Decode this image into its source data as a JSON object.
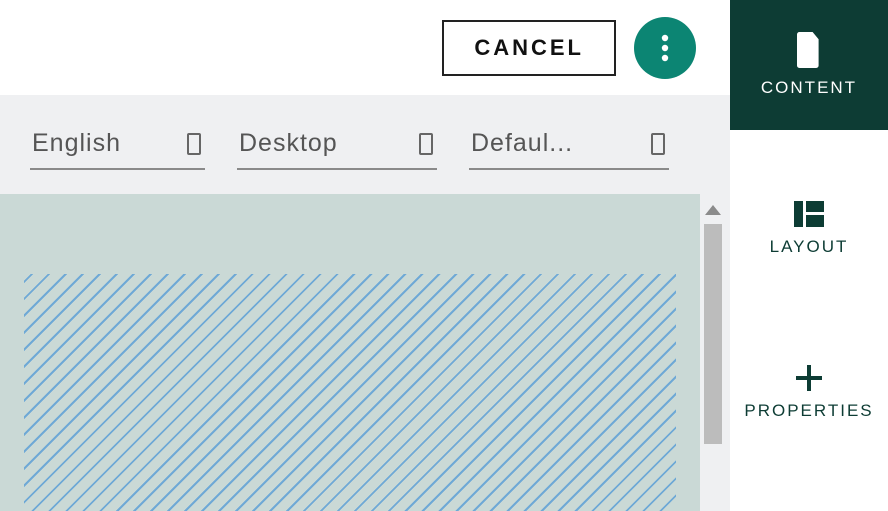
{
  "topbar": {
    "cancel_label": "CANCEL"
  },
  "filters": {
    "language": "English",
    "device": "Desktop",
    "state": "Defaul..."
  },
  "sidebar": {
    "content": "CONTENT",
    "layout": "LAYOUT",
    "properties": "PROPERTIES"
  }
}
